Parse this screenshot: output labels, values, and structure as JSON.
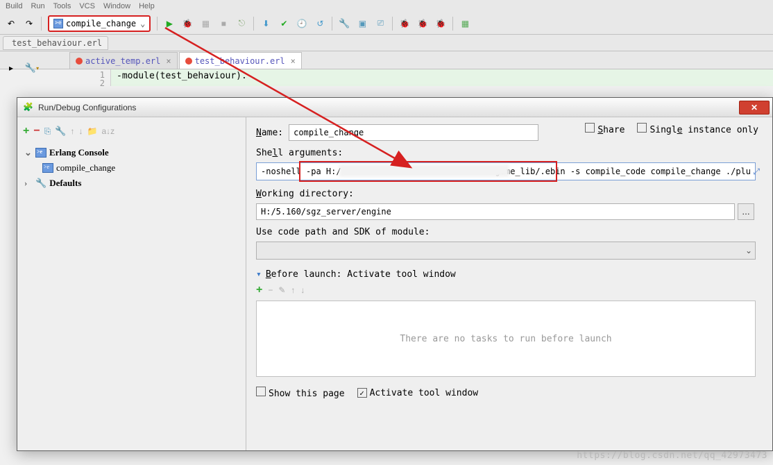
{
  "menubar": {
    "items": [
      "Build",
      "Run",
      "Tools",
      "VCS",
      "Window",
      "Help"
    ]
  },
  "toolbar": {
    "run_config_label": "compile_change"
  },
  "file_tab": {
    "label": "test_behaviour.erl"
  },
  "editor_tabs": {
    "tab1": "active_temp.erl",
    "tab2": "test_behaviour.erl"
  },
  "gutter": {
    "l1": "1",
    "l2": "2"
  },
  "code_line": "-module(test_behaviour).",
  "dialog": {
    "title": "Run/Debug Configurations",
    "share_label": "Share",
    "single_instance_label": "Single instance only",
    "tree": {
      "root1": "Erlang Console",
      "child1": "compile_change",
      "root2": "Defaults"
    },
    "name_label": "Name:",
    "name_value": "compile_change",
    "shell_label": "Shell arguments:",
    "shell_prefix": "-noshell",
    "shell_pa": "-pa H:/",
    "shell_mid": "game_lib/.ebin",
    "shell_suffix": "-s compile_code compile_change ./plu",
    "wd_label": "Working directory:",
    "wd_value": "H:/5.160/sgz_server/engine",
    "codepath_label": "Use code path and SDK of module:",
    "before_label": "Before launch: Activate tool window",
    "no_tasks": "There are no tasks to run before launch",
    "show_page": "Show this page",
    "activate_tw": "Activate tool window"
  },
  "watermark": "https://blog.csdn.net/qq_42973473"
}
